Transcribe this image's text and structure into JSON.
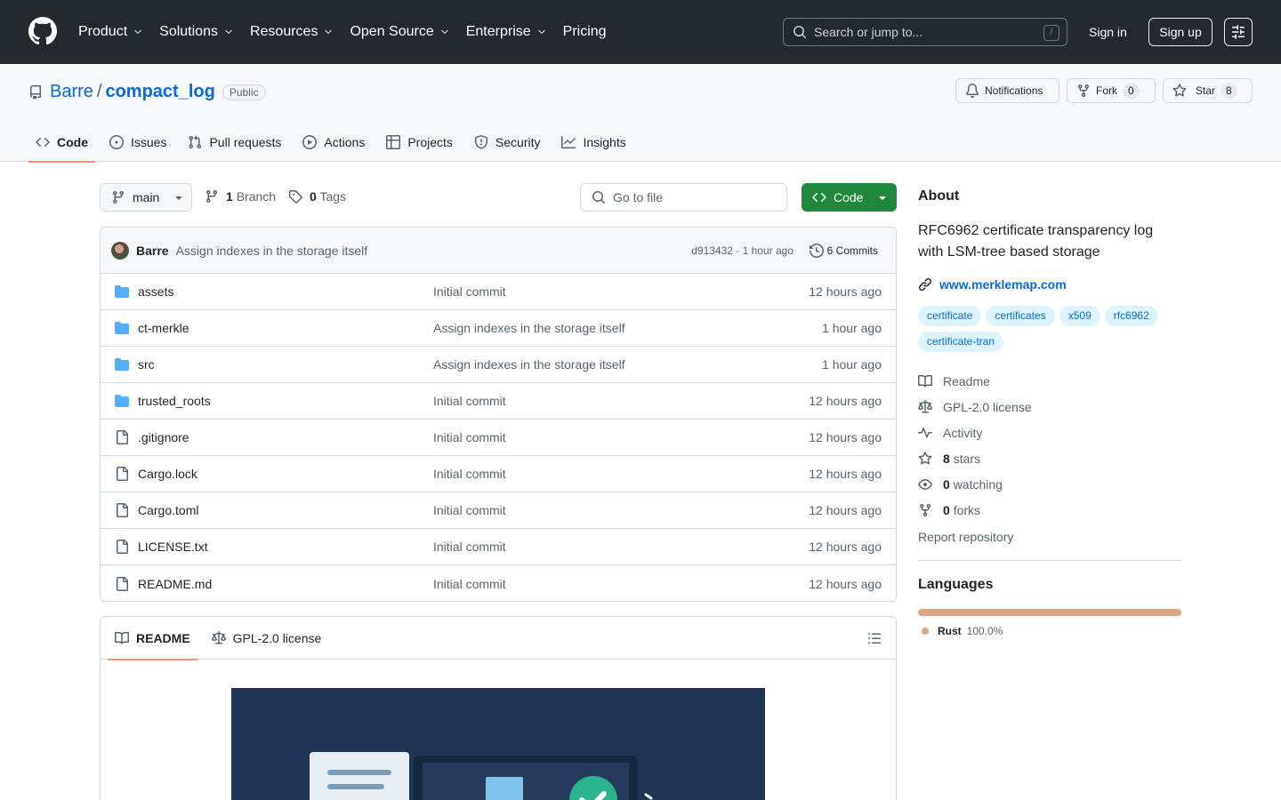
{
  "header": {
    "nav": [
      {
        "label": "Product",
        "has_menu": true
      },
      {
        "label": "Solutions",
        "has_menu": true
      },
      {
        "label": "Resources",
        "has_menu": true
      },
      {
        "label": "Open Source",
        "has_menu": true
      },
      {
        "label": "Enterprise",
        "has_menu": true
      },
      {
        "label": "Pricing",
        "has_menu": false
      }
    ],
    "search_placeholder": "Search or jump to...",
    "search_shortcut": "/",
    "signin": "Sign in",
    "signup": "Sign up"
  },
  "repo": {
    "owner": "Barre",
    "separator": "/",
    "name": "compact_log",
    "visibility": "Public",
    "notifications": "Notifications",
    "fork_label": "Fork",
    "fork_count": "0",
    "star_label": "Star",
    "star_count": "8"
  },
  "tabs": [
    {
      "label": "Code",
      "icon": "code-icon",
      "active": true
    },
    {
      "label": "Issues",
      "icon": "issue-icon"
    },
    {
      "label": "Pull requests",
      "icon": "pull-request-icon"
    },
    {
      "label": "Actions",
      "icon": "play-icon"
    },
    {
      "label": "Projects",
      "icon": "table-icon"
    },
    {
      "label": "Security",
      "icon": "shield-icon"
    },
    {
      "label": "Insights",
      "icon": "graph-icon"
    }
  ],
  "toolbar": {
    "branch": "main",
    "branch_count": "1",
    "branch_label": "Branch",
    "tag_count": "0",
    "tag_label": "Tags",
    "goto_placeholder": "Go to file",
    "code_button": "Code"
  },
  "latest_commit": {
    "author": "Barre",
    "message": "Assign indexes in the storage itself",
    "meta": "d913432 · 1 hour ago",
    "commits": "6 Commits"
  },
  "files": [
    {
      "type": "dir",
      "name": "assets",
      "message": "Initial commit",
      "time": "12 hours ago"
    },
    {
      "type": "dir",
      "name": "ct-merkle",
      "message": "Assign indexes in the storage itself",
      "time": "1 hour ago"
    },
    {
      "type": "dir",
      "name": "src",
      "message": "Assign indexes in the storage itself",
      "time": "1 hour ago"
    },
    {
      "type": "dir",
      "name": "trusted_roots",
      "message": "Initial commit",
      "time": "12 hours ago"
    },
    {
      "type": "file",
      "name": ".gitignore",
      "message": "Initial commit",
      "time": "12 hours ago"
    },
    {
      "type": "file",
      "name": "Cargo.lock",
      "message": "Initial commit",
      "time": "12 hours ago"
    },
    {
      "type": "file",
      "name": "Cargo.toml",
      "message": "Initial commit",
      "time": "12 hours ago"
    },
    {
      "type": "file",
      "name": "LICENSE.txt",
      "message": "Initial commit",
      "time": "12 hours ago"
    },
    {
      "type": "file",
      "name": "README.md",
      "message": "Initial commit",
      "time": "12 hours ago"
    }
  ],
  "readme": {
    "tab_readme": "README",
    "tab_license": "GPL-2.0 license"
  },
  "about": {
    "heading": "About",
    "description": "RFC6962 certificate transparency log with LSM-tree based storage",
    "website": "www.merklemap.com",
    "topics": [
      "certificate",
      "certificates",
      "x509",
      "rfc6962",
      "certificate-tran"
    ],
    "readme": "Readme",
    "license": "GPL-2.0 license",
    "activity": "Activity",
    "stars_count": "8",
    "stars_label": "stars",
    "watching_count": "0",
    "watching_label": "watching",
    "forks_count": "0",
    "forks_label": "forks",
    "report": "Report repository"
  },
  "languages": {
    "heading": "Languages",
    "items": [
      {
        "name": "Rust",
        "percent": "100.0%",
        "color": "#dea584",
        "fraction": 1.0
      }
    ]
  },
  "colors": {
    "header_bg": "#24292f",
    "link": "#0969da",
    "primary_button": "#1f883d",
    "active_tab_underline": "#fd8c73",
    "folder_icon": "#54aeff"
  }
}
